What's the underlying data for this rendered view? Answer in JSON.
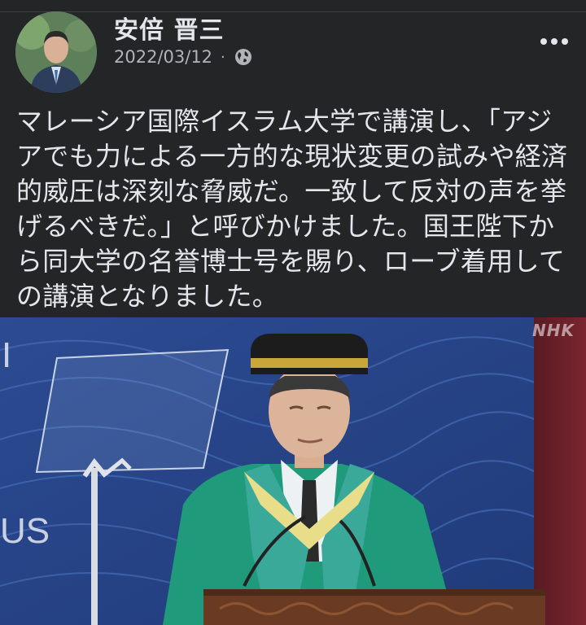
{
  "post": {
    "author": "安倍 晋三",
    "date": "2022/03/12",
    "separator": "·",
    "privacy_icon": "globe-icon",
    "more_icon": "more-options-icon",
    "text": "マレーシア国際イスラム大学で講演し、「アジ\nアでも力による一方的な現状変更の試みや経済\n的威圧は深刻な脅威だ。一致して反対の声を挙\nげるべきだ。」と呼びかけました。国王陛下か\nら同大学の名誉博士号を賜り、ローブ着用して\nの講演となりました。"
  },
  "photo": {
    "watermark": "NHK",
    "background_text_top": "I",
    "background_text_bottom": "US"
  },
  "colors": {
    "background": "#242526",
    "text_primary": "#e4e6eb",
    "text_secondary": "#b0b3b8",
    "robe_green": "#1f9a7a",
    "stage_blue": "#2a4a8e"
  }
}
